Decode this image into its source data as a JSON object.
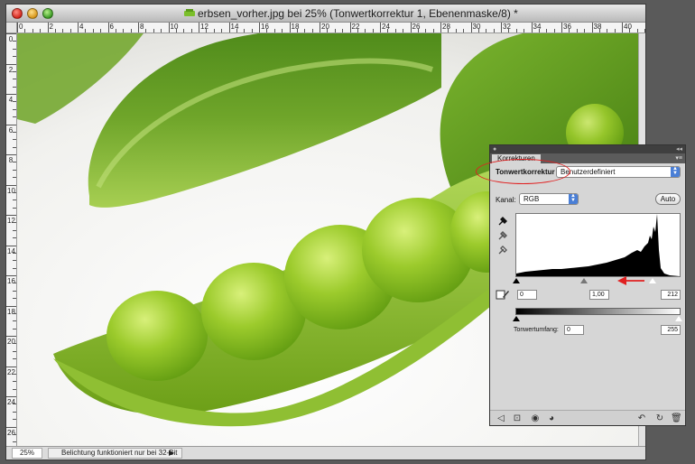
{
  "window": {
    "title": "erbsen_vorher.jpg bei 25% (Tonwertkorrektur 1, Ebenenmaske/8) *"
  },
  "ruler": {
    "h_labels": [
      "0",
      "2",
      "4",
      "6",
      "8",
      "10",
      "12",
      "14",
      "16",
      "18",
      "20",
      "22",
      "24",
      "26",
      "28",
      "30",
      "32",
      "34",
      "36",
      "38",
      "40"
    ],
    "v_labels": [
      "0",
      "2",
      "4",
      "6",
      "8",
      "10",
      "12",
      "14",
      "16",
      "18",
      "20",
      "22",
      "24",
      "26"
    ]
  },
  "status": {
    "zoom": "25%",
    "info": "Belichtung funktioniert nur bei 32-Bit"
  },
  "panel": {
    "tab": "Korrekturen",
    "adjustment_name": "Tonwertkorrektur",
    "preset": "Benutzerdefiniert",
    "channel_label": "Kanal:",
    "channel": "RGB",
    "auto_label": "Auto",
    "input_black": "0",
    "input_gamma": "1,00",
    "input_white": "212",
    "output_label": "Tonwertumfang:",
    "output_black": "0",
    "output_white": "255"
  },
  "annotation_colors": {
    "highlight": "#e02020"
  },
  "icons": [
    "doc-file-icon",
    "eyedropper-black-icon",
    "eyedropper-gray-icon",
    "eyedropper-white-icon",
    "clip-warning-icon",
    "back-arrow-icon",
    "panel-mode-icon",
    "layer-clip-icon",
    "eye-icon",
    "reset-icon",
    "refresh-icon",
    "trash-icon"
  ]
}
